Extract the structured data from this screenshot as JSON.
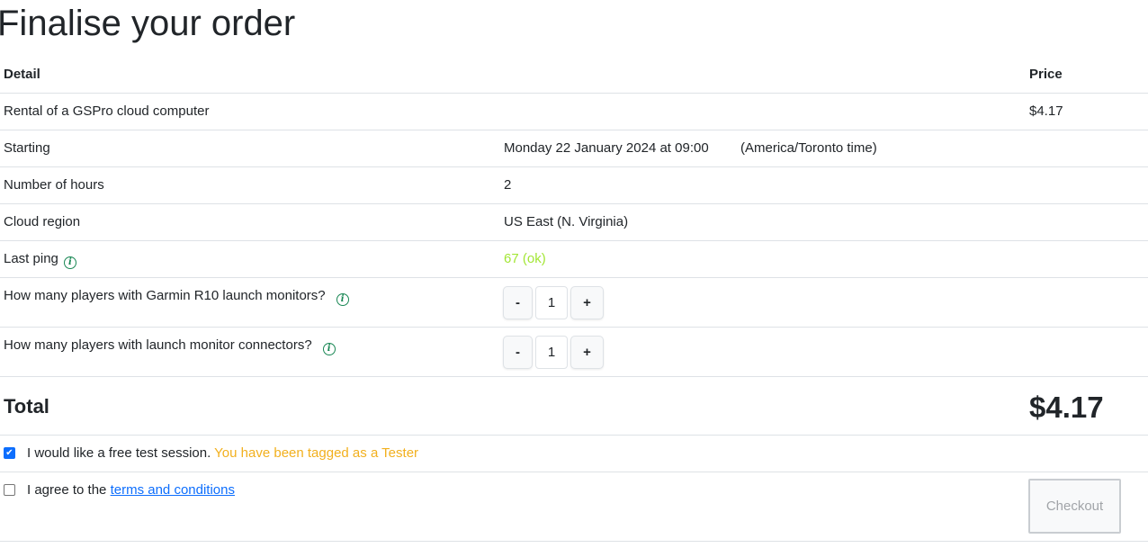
{
  "page_title": "Finalise your order",
  "table": {
    "header_detail": "Detail",
    "header_price": "Price",
    "rental": {
      "label": "Rental of a GSPro cloud computer",
      "price": "$4.17"
    },
    "starting": {
      "label": "Starting",
      "value": "Monday 22 January 2024 at 09:00",
      "timezone": "(America/Toronto time)"
    },
    "hours": {
      "label": "Number of hours",
      "value": "2"
    },
    "region": {
      "label": "Cloud region",
      "value": "US East (N. Virginia)"
    },
    "ping": {
      "label": "Last ping",
      "value": "67 (ok)",
      "value_color": "#a3e635"
    },
    "garmin": {
      "label": "How many players with Garmin R10 launch monitors?",
      "minus": "-",
      "quantity": "1",
      "plus": "+"
    },
    "connectors": {
      "label": "How many players with launch monitor connectors?",
      "minus": "-",
      "quantity": "1",
      "plus": "+"
    },
    "total": {
      "label": "Total",
      "value": "$4.17"
    }
  },
  "test_session": {
    "checked": true,
    "label": "I would like a free test session.",
    "note": "You have been tagged as a Tester",
    "note_color": "#f2b01e"
  },
  "terms": {
    "checked": false,
    "label": "I agree to the",
    "link": "terms and conditions"
  },
  "checkout_label": "Checkout",
  "info_icon_glyph": "i"
}
